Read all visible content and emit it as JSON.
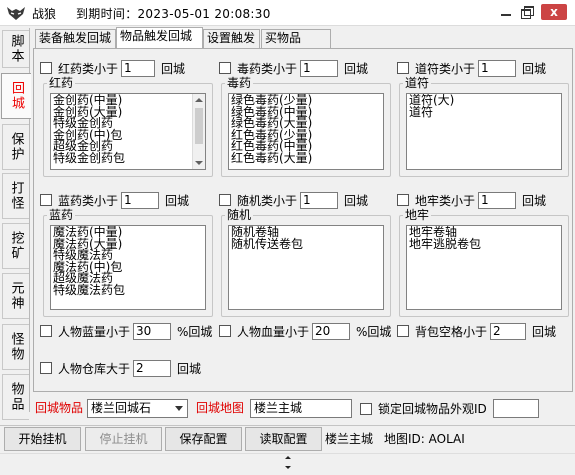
{
  "window": {
    "title": "战狼",
    "expiry": "到期时间：2023-05-01 20:08:30",
    "close_label": "x"
  },
  "side_tabs": [
    "脚本",
    "回城",
    "保护",
    "打怪",
    "挖矿",
    "元神",
    "怪物",
    "物品"
  ],
  "top_tabs": [
    "装备触发回城",
    "物品触发回城",
    "设置触发",
    "买物品"
  ],
  "groups": [
    {
      "check_label": "红药类小于",
      "value": "1",
      "suffix": "回城",
      "title": "红药",
      "items": [
        "金创药(中量)",
        "金创药(大量)",
        "特级金创药",
        "金创药(中)包",
        "超级金创药",
        "特级金创药包"
      ]
    },
    {
      "check_label": "毒药类小于",
      "value": "1",
      "suffix": "回城",
      "title": "毒药",
      "items": [
        "绿色毒药(少量)",
        "绿色毒药(中量)",
        "绿色毒药(大量)",
        "红色毒药(少量)",
        "红色毒药(中量)",
        "红色毒药(大量)"
      ]
    },
    {
      "check_label": "道符类小于",
      "value": "1",
      "suffix": "回城",
      "title": "道符",
      "items": [
        "道符(大)",
        "道符"
      ]
    },
    {
      "check_label": "蓝药类小于",
      "value": "1",
      "suffix": "回城",
      "title": "蓝药",
      "items": [
        "魔法药(中量)",
        "魔法药(大量)",
        "特级魔法药",
        "魔法药(中)包",
        "超级魔法药",
        "特级魔法药包"
      ]
    },
    {
      "check_label": "随机类小于",
      "value": "1",
      "suffix": "回城",
      "title": "随机",
      "items": [
        "随机卷轴",
        "随机传送卷包"
      ]
    },
    {
      "check_label": "地牢类小于",
      "value": "1",
      "suffix": "回城",
      "title": "地牢",
      "items": [
        "地牢卷轴",
        "地牢逃脱卷包"
      ]
    }
  ],
  "options": {
    "mp_label": "人物蓝量小于",
    "mp_value": "30",
    "mp_suffix": "%回城",
    "hp_label": "人物血量小于",
    "hp_value": "20",
    "hp_suffix": "%回城",
    "bag_label": "背包空格小于",
    "bag_value": "2",
    "bag_suffix": "回城",
    "storage_label": "人物仓库大于",
    "storage_value": "2",
    "storage_suffix": "回城"
  },
  "return": {
    "item_label": "回城物品",
    "item_value": "楼兰回城石",
    "map_label": "回城地图",
    "map_value": "楼兰主城",
    "lock_label": "锁定回城物品外观ID",
    "lock_value": ""
  },
  "bottom": {
    "start": "开始挂机",
    "stop": "停止挂机",
    "save": "保存配置",
    "load": "读取配置",
    "location": "楼兰主城",
    "map_id": "地图ID: AOLAI"
  },
  "colors": {
    "accent_red": "#e00000",
    "tab_bg": "#f0f0f0",
    "list_bg": "#ffffff"
  }
}
